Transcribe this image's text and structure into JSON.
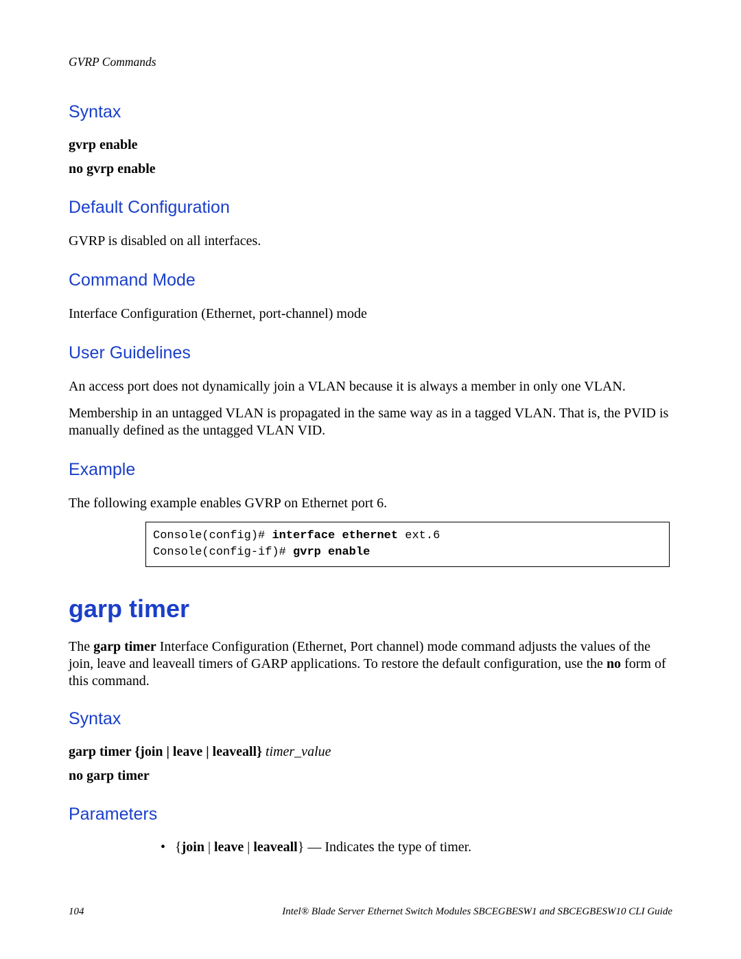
{
  "running_head": "GVRP Commands",
  "sec1": {
    "syntax_h": "Syntax",
    "syntax_l1": "gvrp enable",
    "syntax_l2": "no gvrp enable",
    "defcfg_h": "Default Configuration",
    "defcfg_p": "GVRP is disabled on all interfaces.",
    "mode_h": "Command Mode",
    "mode_p": "Interface Configuration (Ethernet, port-channel) mode",
    "guide_h": "User Guidelines",
    "guide_p1": "An access port does not dynamically join a VLAN because it is always a member in only one VLAN.",
    "guide_p2": "Membership in an untagged VLAN is propagated in the same way as in a tagged VLAN. That is, the PVID is manually defined as the untagged VLAN VID.",
    "example_h": "Example",
    "example_p": "The following example enables GVRP on Ethernet port 6.",
    "code_prompt1": "Console(config)# ",
    "code_cmd1": "interface ethernet ",
    "code_arg1": "ext.6",
    "code_prompt2": "Console(config-if)# ",
    "code_cmd2": "gvrp enable"
  },
  "cmd2": {
    "title": "garp timer",
    "desc_pre": "The ",
    "desc_bold1": "garp timer",
    "desc_mid": " Interface Configuration (Ethernet, Port channel) mode command adjusts the values of the join, leave and leaveall timers of GARP applications. To restore the default configuration, use the ",
    "desc_bold2": "no",
    "desc_post": " form of this command.",
    "syntax_h": "Syntax",
    "syntax_l1_a": "garp timer ",
    "syntax_l1_b": "{",
    "syntax_l1_c": "join",
    "syntax_l1_d": " | ",
    "syntax_l1_e": "leave",
    "syntax_l1_f": " | ",
    "syntax_l1_g": "leaveall",
    "syntax_l1_h": "}",
    "syntax_l1_i": " timer_value",
    "syntax_l2": "no garp timer",
    "params_h": "Parameters",
    "param_bullet": "•",
    "param_b1": "{",
    "param_b2": "join",
    "param_b3": " | ",
    "param_b4": "leave",
    "param_b5": " | ",
    "param_b6": "leaveall",
    "param_b7": "}",
    "param_rest": " — Indicates the type of timer."
  },
  "footer": {
    "page": "104",
    "title": "Intel® Blade Server Ethernet Switch Modules SBCEGBESW1 and SBCEGBESW10 CLI Guide"
  }
}
